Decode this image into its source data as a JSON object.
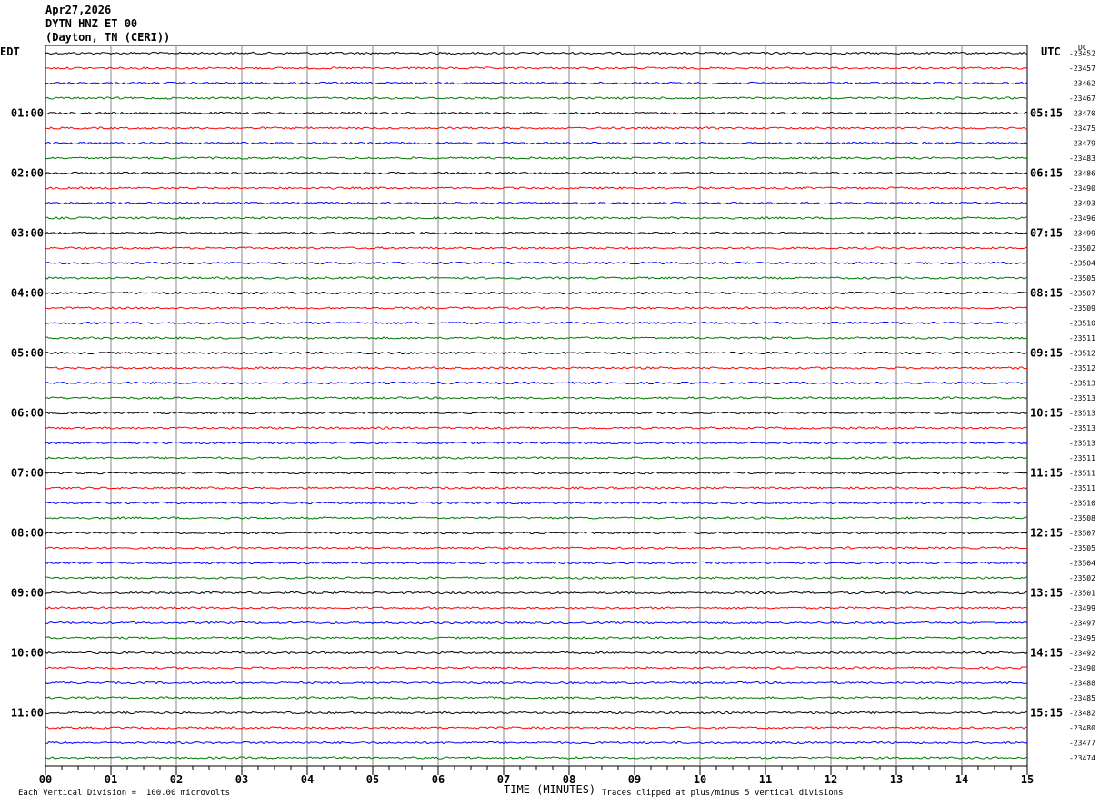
{
  "header": {
    "line1": "Apr27,2026",
    "line2": "DYTN HNZ ET 00",
    "line3": "(Dayton, TN (CERI))"
  },
  "labels": {
    "left_tz": "EDT",
    "right_tz": "UTC",
    "dc": "DC"
  },
  "footer": {
    "scale_note": "Each Vertical Division =  100.00 microvolts",
    "xlabel": "TIME (MINUTES)",
    "clip_note": "Traces clipped at plus/minus 5 vertical divisions"
  },
  "chart_data": {
    "type": "line",
    "title": "DYTN HNZ ET 00",
    "xlabel": "TIME (MINUTES)",
    "x_ticks": [
      "00",
      "01",
      "02",
      "03",
      "04",
      "05",
      "06",
      "07",
      "08",
      "09",
      "10",
      "11",
      "12",
      "13",
      "14",
      "15"
    ],
    "xlim": [
      0,
      15
    ],
    "trace_colors": [
      "#000000",
      "#ff0000",
      "#0000ff",
      "#007700"
    ],
    "left_time_labels": [
      "01:00",
      "02:00",
      "03:00",
      "04:00",
      "05:00",
      "06:00",
      "07:00",
      "08:00",
      "09:00",
      "10:00",
      "11:00"
    ],
    "right_time_labels": [
      "05:15",
      "06:15",
      "07:15",
      "08:15",
      "09:15",
      "10:15",
      "11:15",
      "12:15",
      "13:15",
      "14:15",
      "15:15"
    ],
    "dc_offsets": [
      "-23452",
      "-23457",
      "-23462",
      "-23467",
      "-23470",
      "-23475",
      "-23479",
      "-23483",
      "-23486",
      "-23490",
      "-23493",
      "-23496",
      "-23499",
      "-23502",
      "-23504",
      "-23505",
      "-23507",
      "-23509",
      "-23510",
      "-23511",
      "-23512",
      "-23512",
      "-23513",
      "-23513",
      "-23513",
      "-23513",
      "-23513",
      "-23511",
      "-23511",
      "-23511",
      "-23510",
      "-23508",
      "-23507",
      "-23505",
      "-23504",
      "-23502",
      "-23501",
      "-23499",
      "-23497",
      "-23495",
      "-23492",
      "-23490",
      "-23488",
      "-23485",
      "-23482",
      "-23480",
      "-23477",
      "-23474"
    ]
  }
}
